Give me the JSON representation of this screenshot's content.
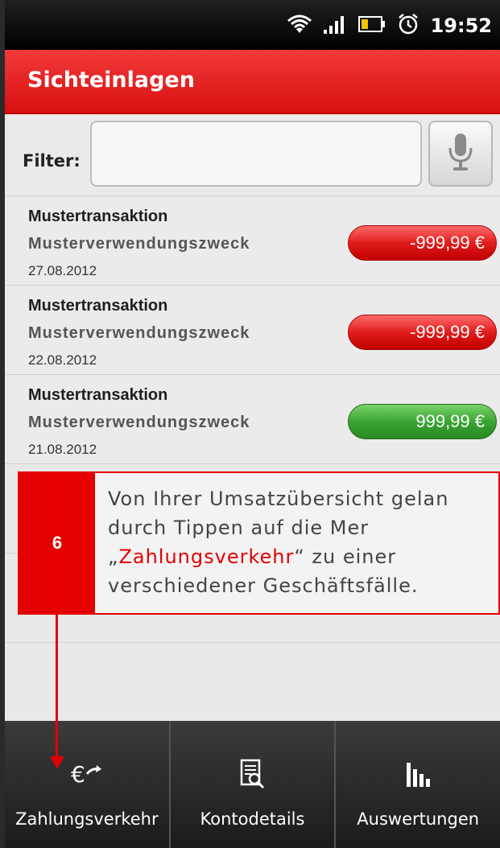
{
  "status": {
    "time": "19:52",
    "icons": [
      "wifi-icon",
      "signal-icon",
      "battery-icon",
      "alarm-icon"
    ]
  },
  "header": {
    "title": "Sichteinlagen"
  },
  "filter": {
    "label": "Filter:",
    "value": "",
    "mic_icon": "microphone-icon"
  },
  "transactions": [
    {
      "title": "Mustertransaktion",
      "purpose": "Musterverwendungszweck",
      "date": "27.08.2012",
      "amount": "-999,99 €",
      "type": "negative"
    },
    {
      "title": "Mustertransaktion",
      "purpose": "Musterverwendungszweck",
      "date": "22.08.2012",
      "amount": "-999,99 €",
      "type": "negative"
    },
    {
      "title": "Mustertransaktion",
      "purpose": "Musterverwendungszweck",
      "date": "21.08.2012",
      "amount": "999,99 €",
      "type": "positive"
    }
  ],
  "callout": {
    "number": "6",
    "line1": "Von Ihrer Umsatzübersicht gelan",
    "line2": "durch Tippen auf die Mer",
    "line3_pre": "„",
    "line3_highlight": "Zahlungsverkehr",
    "line3_post": "“ zu einer",
    "line4": "verschiedener Geschäftsfälle."
  },
  "tabs": [
    {
      "label": "Zahlungsverkehr",
      "icon": "euro-transfer-icon"
    },
    {
      "label": "Kontodetails",
      "icon": "document-search-icon"
    },
    {
      "label": "Auswertungen",
      "icon": "bar-chart-icon"
    }
  ],
  "colors": {
    "accent": "#e30000",
    "negative": "#d11414",
    "positive": "#3aa532"
  }
}
